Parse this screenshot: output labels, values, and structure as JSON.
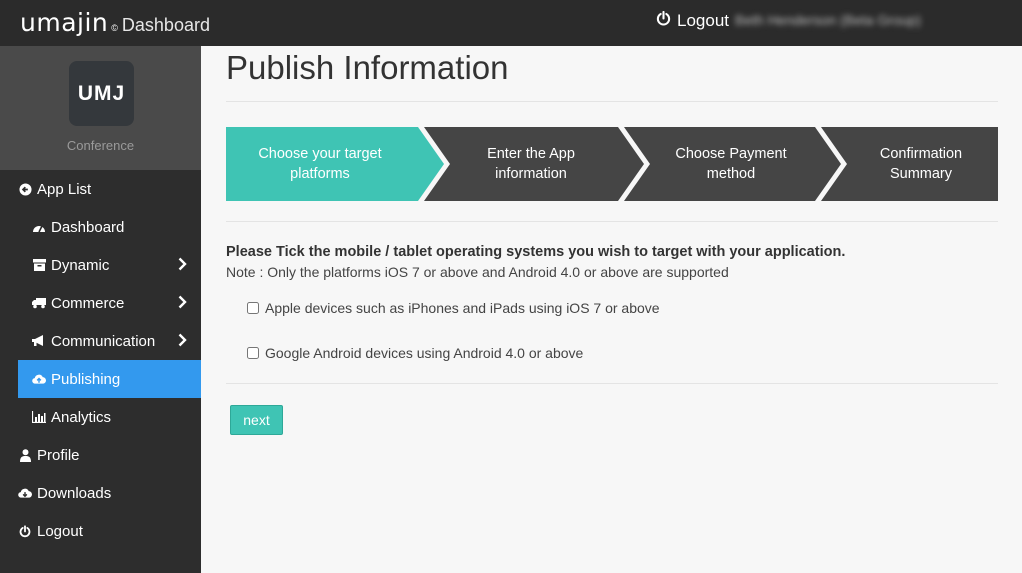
{
  "header": {
    "brand": "umajin",
    "brand_mark": "©",
    "app_name": "Dashboard",
    "logout_label": "Logout",
    "user_name": "Beth Henderson (Beta Group)"
  },
  "sidebar": {
    "logo_text": "UMJ",
    "logo_caption": "Conference",
    "items": [
      {
        "label": "App List",
        "icon": "arrow-circle-left-icon"
      },
      {
        "label": "Dashboard",
        "icon": "tachometer-icon"
      },
      {
        "label": "Dynamic",
        "icon": "archive-icon"
      },
      {
        "label": "Commerce",
        "icon": "truck-icon"
      },
      {
        "label": "Communication",
        "icon": "bullhorn-icon"
      },
      {
        "label": "Publishing",
        "icon": "cloud-upload-icon"
      },
      {
        "label": "Analytics",
        "icon": "bar-chart-icon"
      },
      {
        "label": "Profile",
        "icon": "user-icon"
      },
      {
        "label": "Downloads",
        "icon": "cloud-download-icon"
      },
      {
        "label": "Logout",
        "icon": "power-icon"
      }
    ]
  },
  "main": {
    "title": "Publish Information",
    "steps": [
      {
        "line1": "Choose your target",
        "line2": "platforms",
        "active": true
      },
      {
        "line1": "Enter the App",
        "line2": "information",
        "active": false
      },
      {
        "line1": "Choose Payment",
        "line2": "method",
        "active": false
      },
      {
        "line1": "Confirmation",
        "line2": "Summary",
        "active": false
      }
    ],
    "instruction": "Please Tick the mobile / tablet operating systems you wish to target with your application.",
    "note": "Note : Only the platforms iOS 7 or above and Android 4.0 or above are supported",
    "options": [
      {
        "label": "Apple devices such as iPhones and iPads using iOS 7 or above",
        "checked": false
      },
      {
        "label": "Google Android devices using Android 4.0 or above",
        "checked": false
      }
    ],
    "next_label": "next"
  },
  "colors": {
    "accent_teal": "#3fc4b4",
    "active_nav": "#3399ee",
    "step_dark": "#454545",
    "topbar": "#2b2b2b"
  }
}
